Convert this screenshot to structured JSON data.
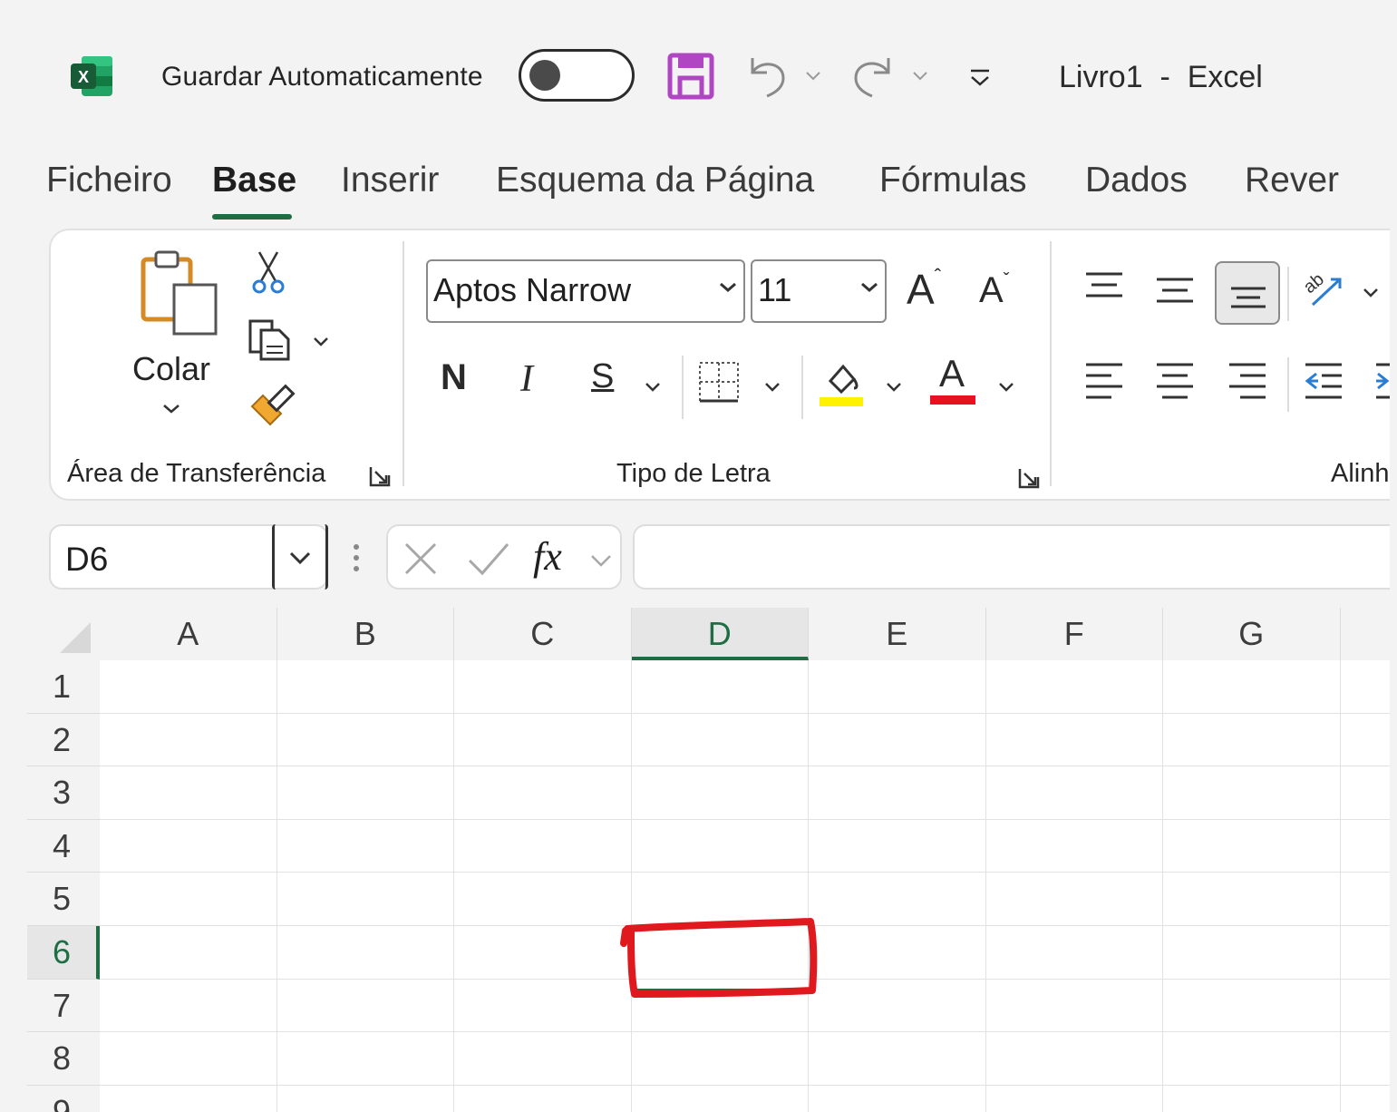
{
  "app": {
    "autosave_label": "Guardar Automaticamente",
    "autosave_on": false,
    "title": "Livro1  -  Excel",
    "accent_color": "#1e6d43",
    "save_icon_color": "#b146c2"
  },
  "tabs": [
    "Ficheiro",
    "Base",
    "Inserir",
    "Esquema da Página",
    "Fórmulas",
    "Dados",
    "Rever"
  ],
  "active_tab": "Base",
  "ribbon": {
    "clipboard": {
      "paste_label": "Colar",
      "group_label": "Área de Transferência",
      "icons": [
        "paste-icon",
        "cut-icon",
        "copy-icon",
        "format-painter-icon"
      ]
    },
    "font": {
      "font_name": "Aptos Narrow",
      "font_size": "11",
      "bold_label": "N",
      "italic_label": "I",
      "underline_label": "S",
      "font_color_label": "A",
      "grow_label": "A",
      "shrink_label": "A",
      "group_label": "Tipo de Letra",
      "highlight_color": "#fff200",
      "font_color": "#e81123"
    },
    "alignment": {
      "group_label": "Alinh"
    }
  },
  "formula_bar": {
    "name_box": "D6",
    "fx_label": "fx",
    "formula": ""
  },
  "grid": {
    "columns": [
      "A",
      "B",
      "C",
      "D",
      "E",
      "F",
      "G"
    ],
    "rows": [
      "1",
      "2",
      "3",
      "4",
      "5",
      "6",
      "7",
      "8",
      "9"
    ],
    "selected_cell": "D6",
    "annotation_color": "#e0191f"
  }
}
